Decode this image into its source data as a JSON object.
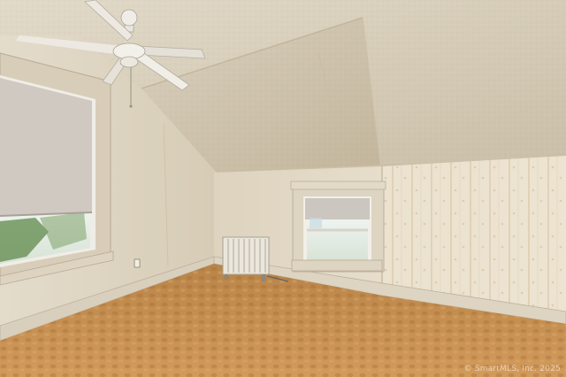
{
  "photo": {
    "watermark": "© SmartMLS, Inc. 2025"
  },
  "palette": {
    "ceiling": "#d6cdbb",
    "wall": "#e0d7c4",
    "carpet": "#c89356",
    "trim": "#d9cfbb",
    "shade": "#cfc9c2"
  }
}
